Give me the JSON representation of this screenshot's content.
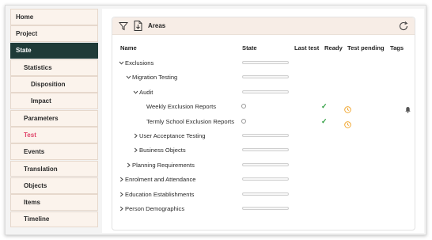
{
  "sidebar": {
    "items": [
      {
        "label": "Home",
        "level": 0,
        "state": "normal"
      },
      {
        "label": "Project",
        "level": 0,
        "state": "normal"
      },
      {
        "label": "State",
        "level": 0,
        "state": "active"
      },
      {
        "label": "Statistics",
        "level": 1,
        "state": "normal"
      },
      {
        "label": "Disposition",
        "level": 2,
        "state": "normal"
      },
      {
        "label": "Impact",
        "level": 2,
        "state": "normal"
      },
      {
        "label": "Parameters",
        "level": 1,
        "state": "normal"
      },
      {
        "label": "Test",
        "level": 1,
        "state": "highlight"
      },
      {
        "label": "Events",
        "level": 1,
        "state": "normal"
      },
      {
        "label": "Translation",
        "level": 1,
        "state": "normal"
      },
      {
        "label": "Objects",
        "level": 1,
        "state": "normal"
      },
      {
        "label": "Items",
        "level": 1,
        "state": "normal"
      },
      {
        "label": "Timeline",
        "level": 1,
        "state": "normal"
      }
    ]
  },
  "panel": {
    "title": "Areas",
    "icons": {
      "filter": "filter-icon",
      "export": "file-export-icon",
      "refresh": "refresh-icon"
    },
    "columns": {
      "name": "Name",
      "state": "State",
      "last_test": "Last test",
      "ready": "Ready",
      "test_pending": "Test pending",
      "tags": "Tags"
    },
    "rows": [
      {
        "label": "Exclusions",
        "depth": 0,
        "expanded": true,
        "leaf": false,
        "ready": "",
        "pending": false,
        "tag": false
      },
      {
        "label": "Migration Testing",
        "depth": 1,
        "expanded": true,
        "leaf": false,
        "ready": "",
        "pending": false,
        "tag": false
      },
      {
        "label": "Audit",
        "depth": 2,
        "expanded": true,
        "leaf": false,
        "ready": "",
        "pending": false,
        "tag": false
      },
      {
        "label": "Weekly Exclusion Reports",
        "depth": 3,
        "expanded": false,
        "leaf": true,
        "ready": "✓",
        "pending": true,
        "tag": true
      },
      {
        "label": "Termly School Exclusion Reports",
        "depth": 3,
        "expanded": false,
        "leaf": true,
        "ready": "✓",
        "pending": true,
        "tag": false
      },
      {
        "label": "User Acceptance Testing",
        "depth": 2,
        "expanded": false,
        "leaf": false,
        "ready": "",
        "pending": false,
        "tag": false
      },
      {
        "label": "Business Objects",
        "depth": 2,
        "expanded": false,
        "leaf": false,
        "ready": "",
        "pending": false,
        "tag": false
      },
      {
        "label": "Planning Requirements",
        "depth": 1,
        "expanded": false,
        "leaf": false,
        "ready": "",
        "pending": false,
        "tag": false
      },
      {
        "label": "Enrolment and Attendance",
        "depth": 0,
        "expanded": false,
        "leaf": false,
        "ready": "",
        "pending": false,
        "tag": false
      },
      {
        "label": "Education Establishments",
        "depth": 0,
        "expanded": false,
        "leaf": false,
        "ready": "",
        "pending": false,
        "tag": false
      },
      {
        "label": "Person Demographics",
        "depth": 0,
        "expanded": false,
        "leaf": false,
        "ready": "",
        "pending": false,
        "tag": false
      }
    ]
  },
  "colors": {
    "active_nav": "#1f3b38",
    "highlight_text": "#e0456a",
    "ready_check": "#2e9e3f",
    "pending_clock": "#f0a020",
    "nav_bg": "#fbf3ec"
  }
}
